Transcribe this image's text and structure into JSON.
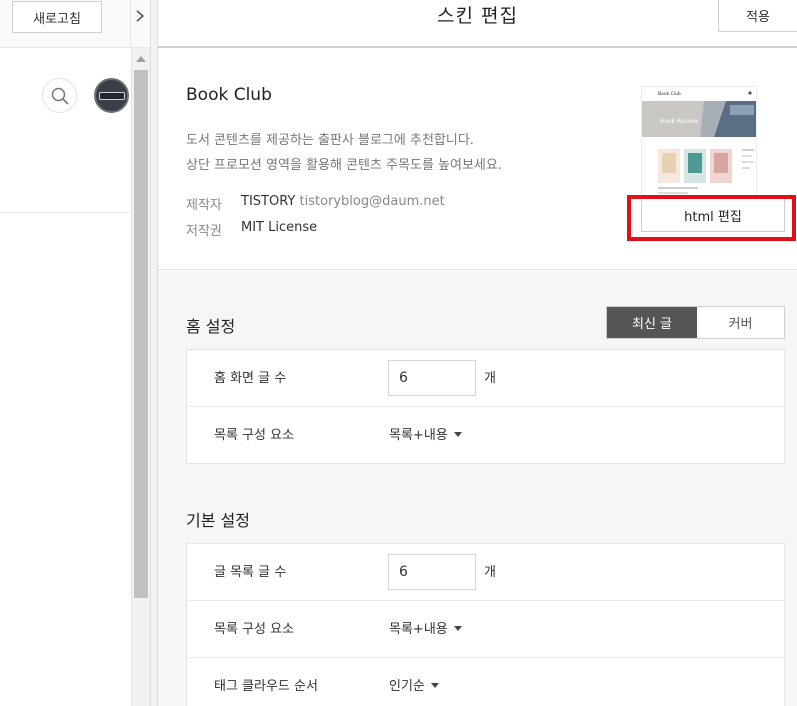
{
  "left_panel": {
    "refresh_label": "새로고침",
    "collapse_icon": "chevron-right-icon",
    "search_icon": "search-icon"
  },
  "header": {
    "title": "스킨 편집",
    "apply_label": "적용"
  },
  "skin": {
    "name": "Book Club",
    "description": [
      "도서 콘텐츠를 제공하는 출판사 블로그에 추천합니다.",
      "상단 프로모션 영역을 활용해 콘텐츠 주목도를 높여보세요."
    ],
    "maker_label": "제작자",
    "maker_name": "TISTORY",
    "maker_email": "tistoryblog@daum.net",
    "license_label": "저작권",
    "license_value": "MIT License",
    "html_edit_label": "html 편집",
    "thumbnail": {
      "title": "Book Club",
      "banner_text": "Book Review"
    }
  },
  "home_settings": {
    "title": "홈 설정",
    "tabs": [
      "최신 글",
      "커버"
    ],
    "active_tab": "최신 글",
    "rows": [
      {
        "label": "홈 화면 글 수",
        "value": "6",
        "unit": "개"
      },
      {
        "label": "목록 구성 요소",
        "value": "목록+내용"
      }
    ]
  },
  "basic_settings": {
    "title": "기본 설정",
    "rows": [
      {
        "label": "글 목록 글 수",
        "value": "6",
        "unit": "개"
      },
      {
        "label": "목록 구성 요소",
        "value": "목록+내용"
      },
      {
        "label": "태그 클라우드 순서",
        "value": "인기순"
      }
    ]
  },
  "colors": {
    "highlight": "#e0101b",
    "active_tab_bg": "#555555"
  }
}
